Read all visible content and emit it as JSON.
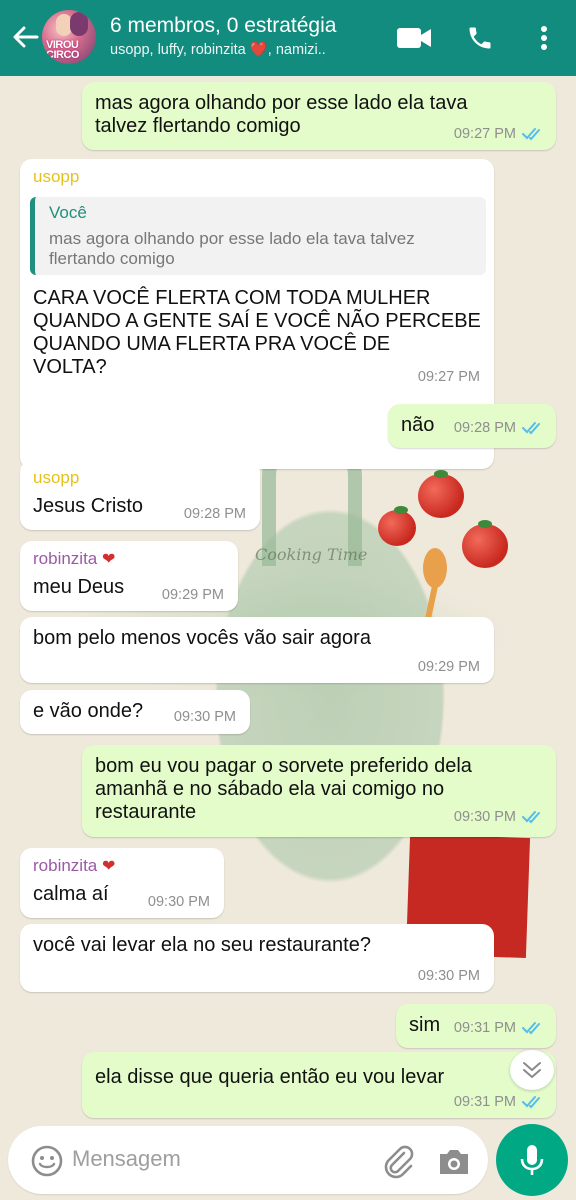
{
  "header": {
    "group_name": "6 membros, 0 estratégia",
    "members_list": "usopp, luffy, robinzita ❤️, namizi..",
    "avatar_text": "VIROU CIRCO"
  },
  "decoration": {
    "apron_text": "Cooking Time"
  },
  "messages": [
    {
      "type": "out",
      "lines": [
        "mas agora olhando por esse lado ela tava",
        "talvez flertando comigo"
      ],
      "time": "09:27 PM",
      "read": true
    },
    {
      "type": "in",
      "sender": "usopp",
      "sender_color": "#e5c21a",
      "quote": {
        "name": "Você",
        "text": "mas agora olhando por esse lado ela tava talvez flertando comigo"
      },
      "lines": [
        "CARA VOCÊ FLERTA COM TODA MULHER",
        "QUANDO A GENTE SAÍ E VOCÊ NÃO PERCEBE",
        "QUANDO UMA FLERTA PRA VOCÊ DE",
        "VOLTA?"
      ],
      "time": "09:27 PM"
    },
    {
      "type": "out",
      "lines": [
        "não"
      ],
      "time": "09:28 PM",
      "read": true
    },
    {
      "type": "in",
      "sender": "usopp",
      "sender_color": "#e5c21a",
      "lines": [
        "Jesus Cristo"
      ],
      "time": "09:28 PM"
    },
    {
      "type": "in",
      "sender": "robinzita",
      "sender_heart": "❤",
      "sender_color": "#9b59a6",
      "lines": [
        "meu Deus"
      ],
      "time": "09:29 PM"
    },
    {
      "type": "in",
      "lines": [
        "bom pelo menos vocês vão sair agora"
      ],
      "time": "09:29 PM"
    },
    {
      "type": "in",
      "lines": [
        "e vão onde?"
      ],
      "time": "09:30 PM"
    },
    {
      "type": "out",
      "lines": [
        "bom eu vou pagar o sorvete preferido dela",
        "amanhã e no sábado ela vai comigo no",
        "restaurante"
      ],
      "time": "09:30 PM",
      "read": true
    },
    {
      "type": "in",
      "sender": "robinzita",
      "sender_heart": "❤",
      "sender_color": "#9b59a6",
      "lines": [
        "calma aí"
      ],
      "time": "09:30 PM"
    },
    {
      "type": "in",
      "lines": [
        "você vai levar ela no seu restaurante?"
      ],
      "time": "09:30 PM"
    },
    {
      "type": "out",
      "lines": [
        "sim"
      ],
      "time": "09:31 PM",
      "read": true
    },
    {
      "type": "out",
      "lines": [
        "ela disse que queria então eu vou levar"
      ],
      "time": "09:31 PM",
      "read": true
    }
  ],
  "input": {
    "placeholder": "Mensagem"
  },
  "colors": {
    "header": "#128c7e",
    "outgoing": "#e3fcca",
    "incoming": "#ffffff",
    "read_ticks": "#53bdeb",
    "mic": "#00a884"
  }
}
